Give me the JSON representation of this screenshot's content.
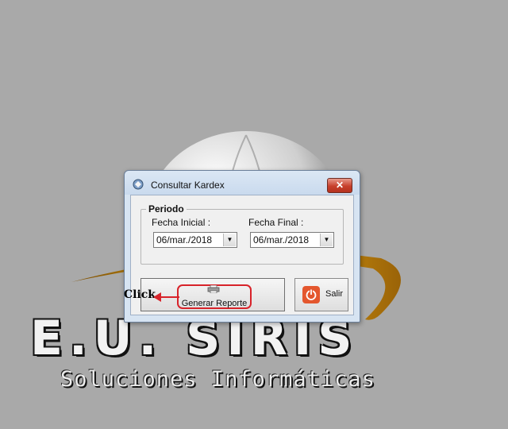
{
  "background": {
    "logo_text": "E.U. SIRIS",
    "tagline": "Soluciones Informáticas"
  },
  "window": {
    "title": "Consultar Kardex",
    "close_icon": "close-x-icon",
    "app_icon": "kardex-app-icon"
  },
  "period_group": {
    "title": "Periodo",
    "start": {
      "label": "Fecha Inicial :",
      "value": "06/mar./2018"
    },
    "end": {
      "label": "Fecha Final :",
      "value": "06/mar./2018"
    },
    "dropdown_icon": "chevron-down-icon"
  },
  "buttons": {
    "generate": {
      "label": "Generar Reporte",
      "icon": "printer-icon"
    },
    "exit": {
      "label": "Salir",
      "icon": "power-icon"
    }
  },
  "annotation": {
    "text": "Click",
    "color": "#d8232a"
  }
}
